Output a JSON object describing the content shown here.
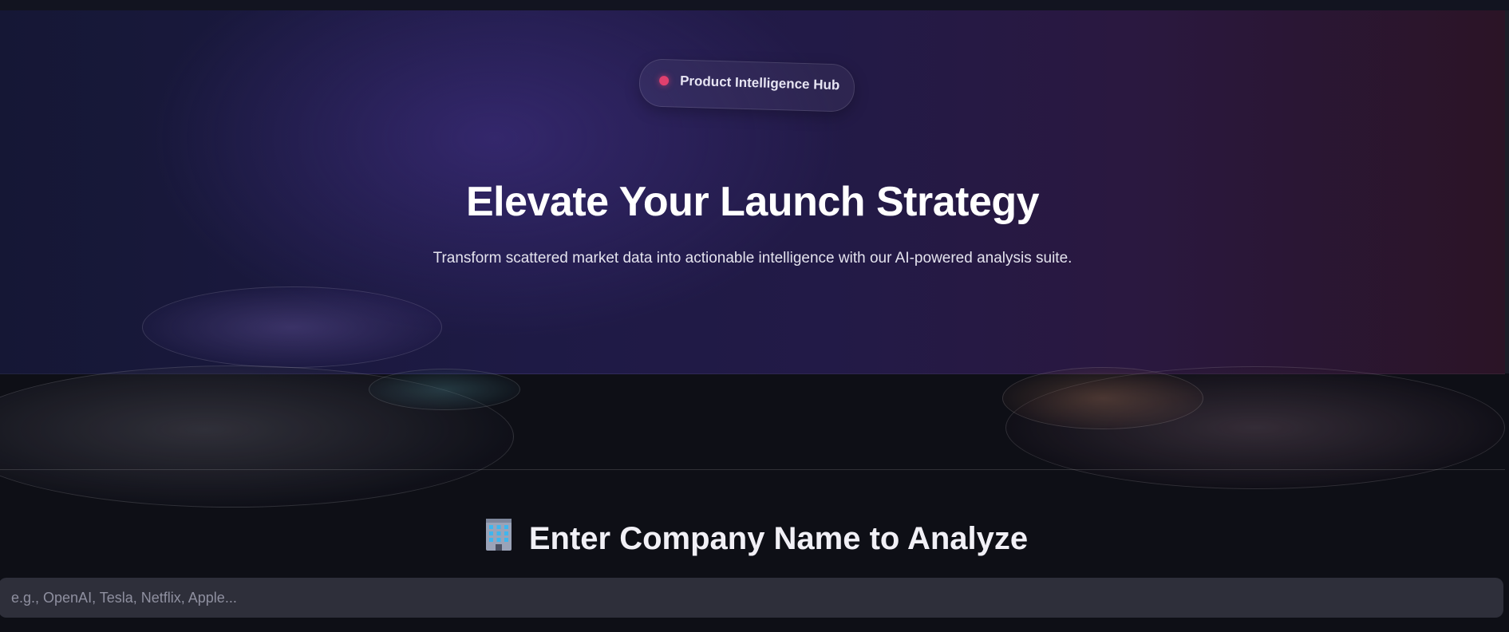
{
  "hero": {
    "badge_label": "Product Intelligence Hub",
    "title": "Elevate Your Launch Strategy",
    "subtitle": "Transform scattered market data into actionable intelligence with our AI-powered analysis suite."
  },
  "analyze": {
    "heading_icon": "office-building-icon",
    "heading": "Enter Company Name to Analyze",
    "input_value": "",
    "input_placeholder": "e.g., OpenAI, Tesla, Netflix, Apple..."
  },
  "colors": {
    "badge_dot": "#e0406e",
    "page_background": "#0e0f16",
    "input_background": "#2e2f3a"
  }
}
